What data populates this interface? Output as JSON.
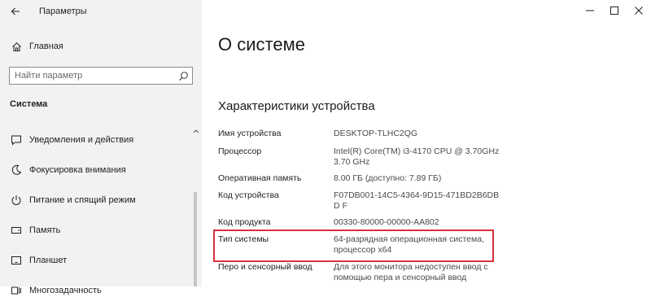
{
  "window": {
    "title": "Параметры",
    "controls": [
      "minimize",
      "maximize",
      "close"
    ]
  },
  "sidebar": {
    "home_label": "Главная",
    "search_placeholder": "Найти параметр",
    "section_title": "Система",
    "items": [
      {
        "label": "Уведомления и действия",
        "icon": "notification-icon"
      },
      {
        "label": "Фокусировка внимания",
        "icon": "moon-icon"
      },
      {
        "label": "Питание и спящий режим",
        "icon": "power-icon"
      },
      {
        "label": "Память",
        "icon": "storage-icon"
      },
      {
        "label": "Планшет",
        "icon": "tablet-icon"
      },
      {
        "label": "Многозадачность",
        "icon": "multitasking-icon"
      }
    ]
  },
  "main": {
    "page_title": "О системе",
    "specs_heading": "Характеристики устройства",
    "specs": [
      {
        "label": "Имя устройства",
        "value": "DESKTOP-TLHC2QG"
      },
      {
        "label": "Процессор",
        "value": "Intel(R) Core(TM) i3-4170 CPU @ 3.70GHz 3.70 GHz"
      },
      {
        "label": "Оперативная память",
        "value": "8.00 ГБ (доступно: 7.89 ГБ)"
      },
      {
        "label": "Код устройства",
        "value": "F07DB001-14C5-4364-9D15-471BD2B6DBD F"
      },
      {
        "label": "Код продукта",
        "value": "00330-80000-00000-AA802"
      },
      {
        "label": "Тип системы",
        "value": "64-разрядная операционная система, процессор x64"
      },
      {
        "label": "Перо и сенсорный ввод",
        "value": "Для этого монитора недоступен ввод с помощью пера и сенсорный ввод"
      }
    ]
  },
  "colors": {
    "sidebar_bg": "#f2f2f2",
    "highlight": "#d9313a"
  }
}
